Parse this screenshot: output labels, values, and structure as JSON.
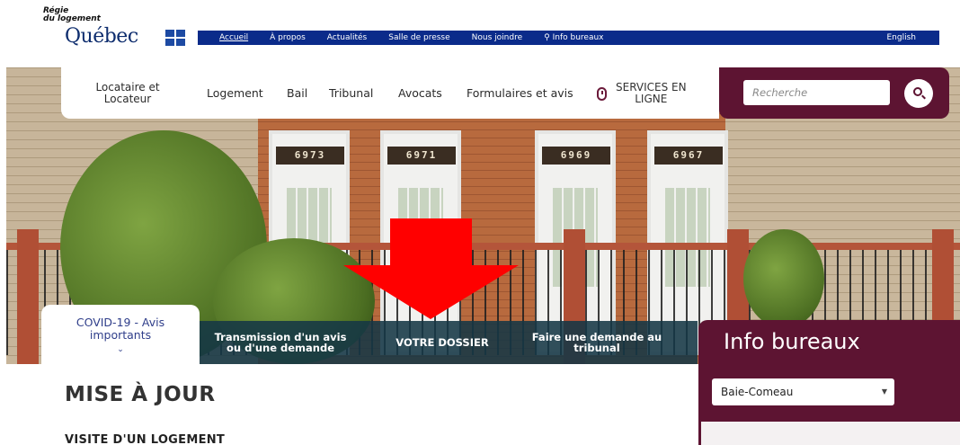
{
  "logo": {
    "line1": "Régie",
    "line2": "du logement",
    "name": "Québec"
  },
  "topbar": {
    "items": [
      "Accueil",
      "À propos",
      "Actualités",
      "Salle de presse",
      "Nous joindre",
      "Info bureaux"
    ],
    "language": "English",
    "location_icon": "map-pin-icon"
  },
  "nav": {
    "locataire_line1": "Locataire et",
    "locataire_line2": "Locateur",
    "logement": "Logement",
    "bail": "Bail",
    "tribunal": "Tribunal",
    "avocats": "Avocats",
    "formulaires": "Formulaires et avis",
    "services_line1": "SERVICES EN",
    "services_line2": "LIGNE"
  },
  "search": {
    "placeholder": "Recherche"
  },
  "hero": {
    "house_numbers": [
      "6973",
      "6971",
      "6969",
      "6967"
    ]
  },
  "tabs": {
    "covid_line1": "COVID-19 - Avis",
    "covid_line2": "importants",
    "transmission_line1": "Transmission d'un avis",
    "transmission_line2": "ou d'une demande",
    "dossier": "VOTRE DOSSIER",
    "demande_line1": "Faire une demande au",
    "demande_line2": "tribunal"
  },
  "info": {
    "title": "Info bureaux",
    "selected_office": "Baie-Comeau"
  },
  "main": {
    "heading": "MISE À JOUR",
    "subheading": "VISITE D'UN LOGEMENT"
  },
  "colors": {
    "topbar_blue": "#0b2b8a",
    "brand_maroon": "#5d1432",
    "arrow_red": "#ff0000",
    "tab_bar": "#143746"
  }
}
